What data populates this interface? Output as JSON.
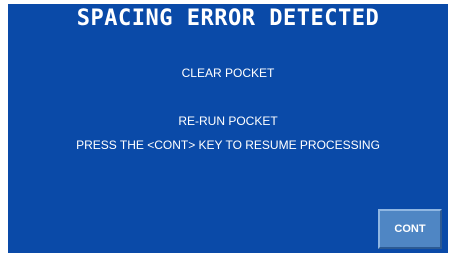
{
  "title": "SPACING ERROR DETECTED",
  "messages": {
    "line1": "CLEAR POCKET",
    "line2": "RE-RUN POCKET",
    "line3": "PRESS THE <CONT> KEY TO RESUME PROCESSING"
  },
  "buttons": {
    "cont_label": "CONT"
  },
  "colors": {
    "background": "#0a4aa8",
    "button": "#4f86c4",
    "text": "#ffffff"
  }
}
